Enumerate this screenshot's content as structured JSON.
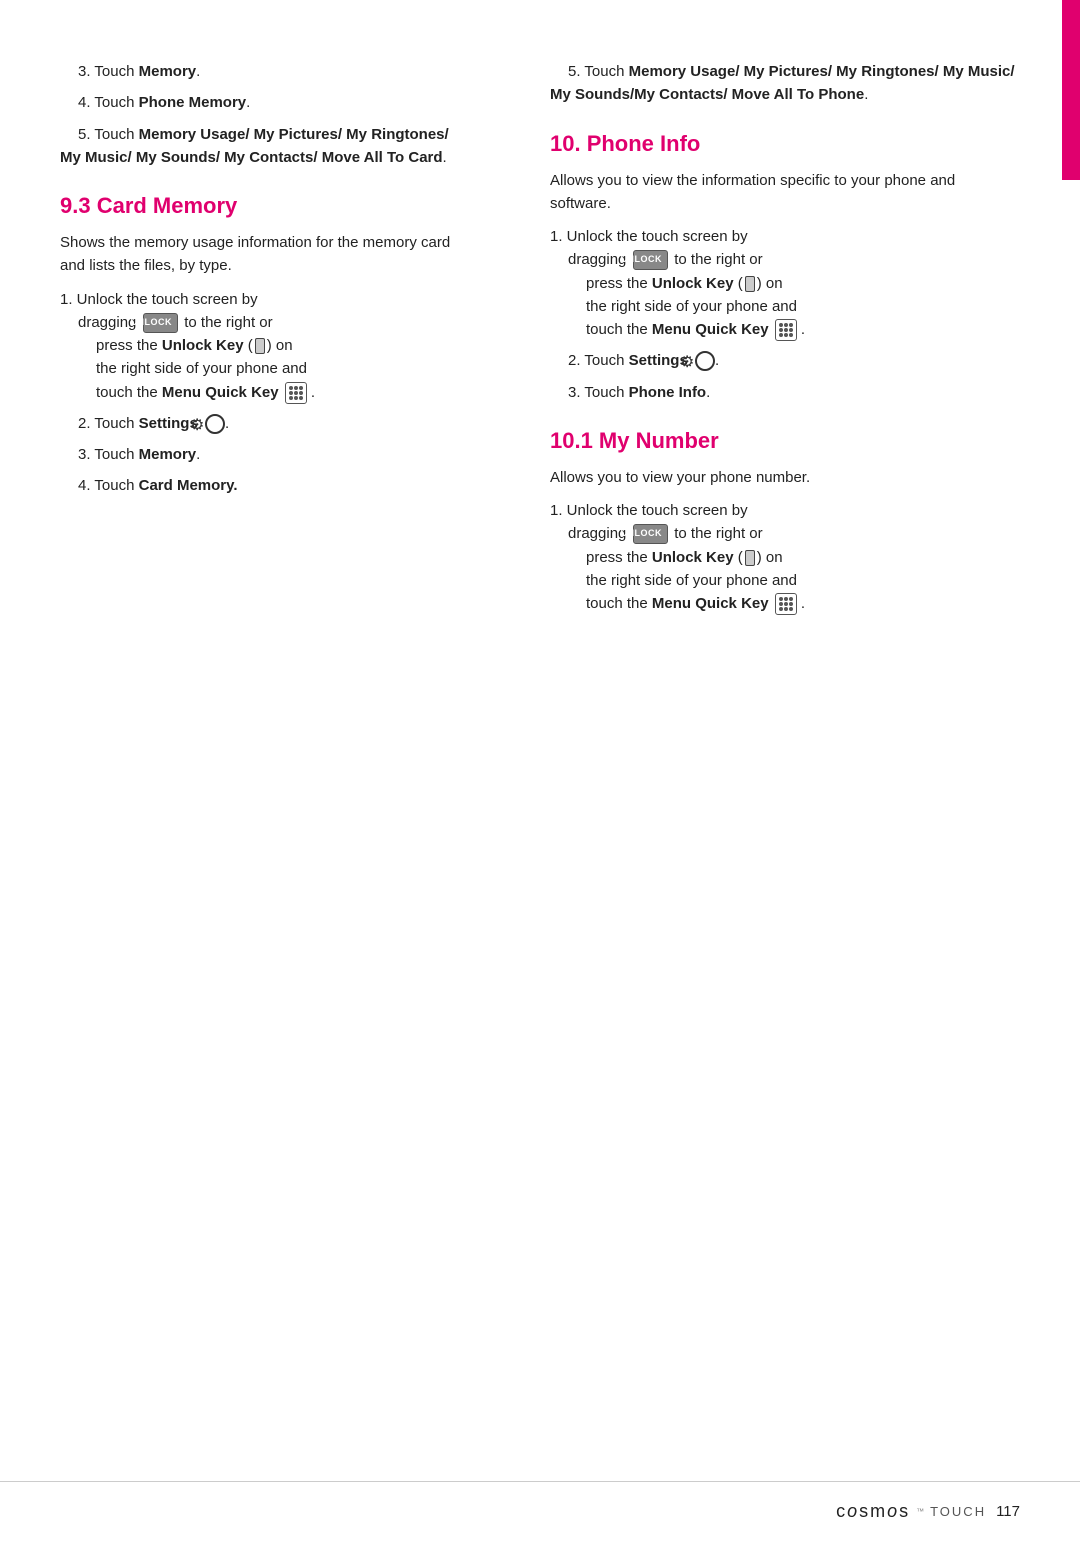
{
  "accent_bar": {
    "color": "#e0006e"
  },
  "left_column": {
    "items_intro": [
      {
        "num": "3.",
        "text": "Touch ",
        "bold": "Memory",
        "rest": "."
      },
      {
        "num": "4.",
        "text": "Touch ",
        "bold": "Phone Memory",
        "rest": "."
      }
    ],
    "item5": {
      "num": "5.",
      "text": "Touch ",
      "bold1": "Memory Usage/ My Pictures/ My Ringtones/ My Music/ My Sounds/ My Contacts/ Move All To Card",
      "rest": "."
    },
    "section93": {
      "heading": "9.3 Card Memory",
      "description": "Shows the memory usage information for the memory card and lists the files, by type.",
      "steps": [
        {
          "num": "1.",
          "line1": "Unlock the touch screen by",
          "line2": "dragging",
          "unlock_label": "UNLOCK",
          "line3": "to the right or",
          "line4": "press the ",
          "bold1": "Unlock Key",
          "line5": " (",
          "line6": ") on",
          "line7": "the right side of your phone and",
          "line8": "touch the ",
          "bold2": "Menu Quick Key",
          "line9": " ."
        },
        {
          "num": "2.",
          "text": "Touch ",
          "bold": "Settings",
          "icon": "settings"
        },
        {
          "num": "3.",
          "text": "Touch ",
          "bold": "Memory",
          "rest": "."
        },
        {
          "num": "4.",
          "text": "Touch ",
          "bold": "Card Memory.",
          "rest": ""
        }
      ]
    }
  },
  "right_column": {
    "item5": {
      "num": "5.",
      "text": "Touch ",
      "bold": "Memory Usage/ My Pictures/ My Ringtones/ My Music/ My Sounds/My Contacts/ Move All To Phone",
      "rest": "."
    },
    "section10": {
      "heading": "10. Phone Info",
      "description": "Allows you to view the information specific to your phone and software.",
      "steps": [
        {
          "num": "1.",
          "line1": "Unlock the touch screen by",
          "line2": "dragging",
          "unlock_label": "UNLOCK",
          "line3": "to the right or",
          "line4": "press the ",
          "bold1": "Unlock Key",
          "line5": " (",
          "line6": ") on",
          "line7": "the right side of your phone and",
          "line8": "touch the ",
          "bold2": "Menu Quick Key",
          "line9": " ."
        },
        {
          "num": "2.",
          "text": "Touch ",
          "bold": "Settings",
          "icon": "settings"
        },
        {
          "num": "3.",
          "text": "Touch ",
          "bold": "Phone Info",
          "rest": "."
        }
      ]
    },
    "section101": {
      "heading": "10.1 My Number",
      "description": "Allows you to view your phone number.",
      "steps": [
        {
          "num": "1.",
          "line1": "Unlock the touch screen by",
          "line2": "dragging",
          "unlock_label": "UNLOCK",
          "line3": "to the right or",
          "line4": "press the ",
          "bold1": "Unlock Key",
          "line5": " (",
          "line6": ") on",
          "line7": "the right side of your phone and",
          "line8": "touch the ",
          "bold2": "Menu Quick Key",
          "line9": " ."
        }
      ]
    }
  },
  "footer": {
    "logo": "cosmos",
    "touch": "TOUCH",
    "page_number": "117"
  }
}
